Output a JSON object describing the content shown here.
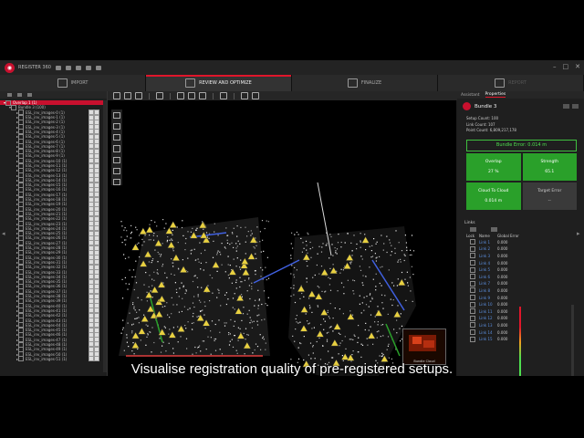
{
  "app": {
    "title": "REGISTER 360"
  },
  "workflow": {
    "steps": [
      {
        "label": "IMPORT"
      },
      {
        "label": "REVIEW AND OPTIMIZE"
      },
      {
        "label": "FINALIZE"
      },
      {
        "label": "REPORT"
      }
    ]
  },
  "tree": {
    "root": "Overlap 1 (1)",
    "bundle": "Bundle 3 (100)",
    "items": [
      "ESL_inv_images-0 (1)",
      "ESL_inv_images-1 (1)",
      "ESL_inv_images-2 (1)",
      "ESL_inv_images-3 (1)",
      "ESL_inv_images-4 (1)",
      "ESL_inv_images-5 (1)",
      "ESL_inv_images-6 (1)",
      "ESL_inv_images-7 (1)",
      "ESL_inv_images-8 (1)",
      "ESL_inv_images-9 (1)",
      "ESL_inv_images-10 (1)",
      "ESL_inv_images-11 (1)",
      "ESL_inv_images-12 (1)",
      "ESL_inv_images-13 (1)",
      "ESL_inv_images-14 (1)",
      "ESL_inv_images-15 (1)",
      "ESL_inv_images-16 (1)",
      "ESL_inv_images-17 (1)",
      "ESL_inv_images-18 (1)",
      "ESL_inv_images-19 (1)",
      "ESL_inv_images-20 (1)",
      "ESL_inv_images-21 (1)",
      "ESL_inv_images-22 (1)",
      "ESL_inv_images-23 (1)",
      "ESL_inv_images-24 (1)",
      "ESL_inv_images-25 (1)",
      "ESL_inv_images-26 (1)",
      "ESL_inv_images-27 (1)",
      "ESL_inv_images-28 (1)",
      "ESL_inv_images-29 (1)",
      "ESL_inv_images-30 (1)",
      "ESL_inv_images-31 (1)",
      "ESL_inv_images-32 (1)",
      "ESL_inv_images-33 (1)",
      "ESL_inv_images-34 (1)",
      "ESL_inv_images-35 (1)",
      "ESL_inv_images-36 (1)",
      "ESL_inv_images-37 (1)",
      "ESL_inv_images-38 (1)",
      "ESL_inv_images-39 (1)",
      "ESL_inv_images-40 (1)",
      "ESL_inv_images-41 (1)",
      "ESL_inv_images-42 (1)",
      "ESL_inv_images-43 (1)",
      "ESL_inv_images-44 (1)",
      "ESL_inv_images-45 (1)",
      "ESL_inv_images-46 (1)",
      "ESL_inv_images-47 (1)",
      "ESL_inv_images-48 (1)",
      "ESL_inv_images-49 (1)",
      "ESL_inv_images-50 (1)",
      "ESL_inv_images-51 (1)"
    ]
  },
  "viewport": {
    "thumbnail_label": "Bundle Cloud"
  },
  "panel": {
    "tabs": [
      "Assistant",
      "Properties"
    ],
    "title": "Bundle 3",
    "stats": [
      "Setup Count: 100",
      "Link Count: 107",
      "Point Count: 6,809,217,178"
    ],
    "error_banner": "Bundle Error: 0.014 m",
    "tiles": [
      {
        "label": "Overlap",
        "value": "27 %",
        "status": "good"
      },
      {
        "label": "Strength",
        "value": "65.1",
        "status": "good"
      },
      {
        "label": "Cloud To Cloud",
        "value": "0.014 m",
        "status": "good"
      },
      {
        "label": "Target Error",
        "value": "--",
        "status": "none"
      }
    ],
    "links_title": "Links",
    "links_columns": [
      "Lock",
      "Name",
      "Global Error"
    ],
    "links": [
      {
        "name": "Link 1",
        "error": "0.000"
      },
      {
        "name": "Link 2",
        "error": "0.000"
      },
      {
        "name": "Link 3",
        "error": "0.000"
      },
      {
        "name": "Link 4",
        "error": "0.000"
      },
      {
        "name": "Link 5",
        "error": "0.000"
      },
      {
        "name": "Link 6",
        "error": "0.000"
      },
      {
        "name": "Link 7",
        "error": "0.000"
      },
      {
        "name": "Link 8",
        "error": "0.000"
      },
      {
        "name": "Link 9",
        "error": "0.000"
      },
      {
        "name": "Link 10",
        "error": "0.000"
      },
      {
        "name": "Link 11",
        "error": "0.000"
      },
      {
        "name": "Link 12",
        "error": "0.000"
      },
      {
        "name": "Link 13",
        "error": "0.000"
      },
      {
        "name": "Link 14",
        "error": "0.000"
      },
      {
        "name": "Link 15",
        "error": "0.000"
      }
    ]
  },
  "colors": {
    "accent": "#e0162b",
    "good": "#2aa02a",
    "link_ok": "#4fdf4f",
    "link_warn": "#e0162b"
  },
  "caption": "Visualise registration quality of pre-registered setups."
}
